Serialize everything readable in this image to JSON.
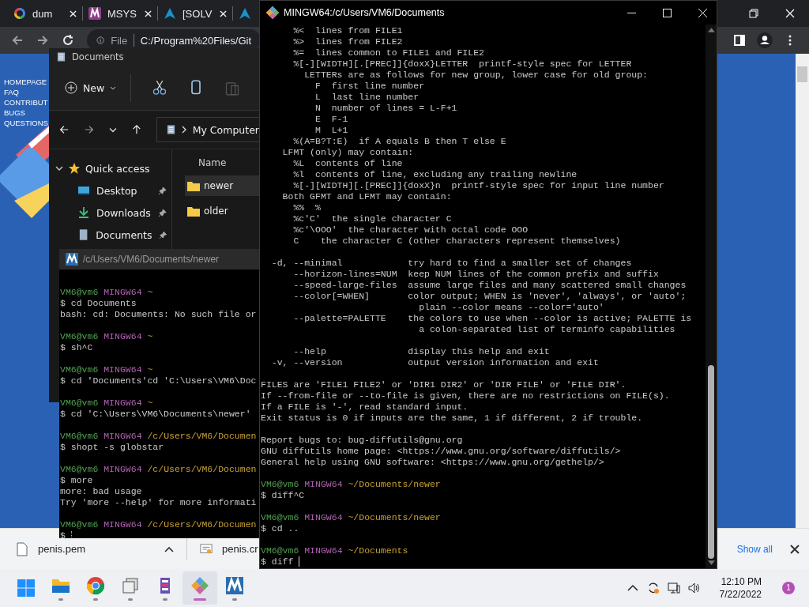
{
  "browser": {
    "tabs": [
      {
        "title": "dum",
        "kind": "ring"
      },
      {
        "title": "MSYS",
        "kind": "zigzag"
      },
      {
        "title": "[SOLV",
        "kind": "peak"
      },
      {
        "kind": "peak"
      }
    ],
    "address": {
      "scheme": "File",
      "url": "C:/Program%20Files/Git"
    },
    "page_links": [
      "HOMEPAGE",
      "FAQ",
      "CONTRIBUT",
      "BUGS",
      "QUESTIONS"
    ]
  },
  "explorer": {
    "title": "Documents",
    "new_button": "New",
    "breadcrumb": "My Computer",
    "column": "Name",
    "nav": [
      {
        "label": "Quick access",
        "expanded": true,
        "children": [
          {
            "label": "Desktop",
            "kind": "desktop",
            "pinned": true
          },
          {
            "label": "Downloads",
            "kind": "download",
            "pinned": true
          },
          {
            "label": "Documents",
            "kind": "document",
            "pinned": true
          }
        ]
      }
    ],
    "files": [
      {
        "name": "newer",
        "selected": true
      },
      {
        "name": "older",
        "selected": false
      }
    ]
  },
  "left_terminal": {
    "title": "/c/Users/VM6/Documents/newer",
    "focused": false,
    "lines": [
      {
        "kind": "blank"
      },
      {
        "kind": "prompt",
        "user": "VM6@vm6",
        "shell": "MINGW64",
        "path": "~"
      },
      {
        "kind": "text",
        "text": "$ cd Documents"
      },
      {
        "kind": "text",
        "text": "bash: cd: Documents: No such file or"
      },
      {
        "kind": "blank"
      },
      {
        "kind": "prompt",
        "user": "VM6@vm6",
        "shell": "MINGW64",
        "path": "~"
      },
      {
        "kind": "text",
        "text": "$ sh^C"
      },
      {
        "kind": "blank"
      },
      {
        "kind": "prompt",
        "user": "VM6@vm6",
        "shell": "MINGW64",
        "path": "~"
      },
      {
        "kind": "text",
        "text": "$ cd 'Documents'cd 'C:\\Users\\VM6\\Doc"
      },
      {
        "kind": "blank"
      },
      {
        "kind": "prompt",
        "user": "VM6@vm6",
        "shell": "MINGW64",
        "path": "~"
      },
      {
        "kind": "text",
        "text": "$ cd 'C:\\Users\\VM6\\Documents\\newer'"
      },
      {
        "kind": "blank"
      },
      {
        "kind": "prompt",
        "user": "VM6@vm6",
        "shell": "MINGW64",
        "path": "/c/Users/VM6/Documen"
      },
      {
        "kind": "text",
        "text": "$ shopt -s globstar"
      },
      {
        "kind": "blank"
      },
      {
        "kind": "prompt",
        "user": "VM6@vm6",
        "shell": "MINGW64",
        "path": "/c/Users/VM6/Documen"
      },
      {
        "kind": "text",
        "text": "$ more"
      },
      {
        "kind": "text",
        "text": "more: bad usage"
      },
      {
        "kind": "text",
        "text": "Try 'more --help' for more informati"
      },
      {
        "kind": "blank"
      },
      {
        "kind": "prompt",
        "user": "VM6@vm6",
        "shell": "MINGW64",
        "path": "/c/Users/VM6/Documen"
      },
      {
        "kind": "input",
        "text": "$ "
      }
    ]
  },
  "main_terminal": {
    "title": "MINGW64:/c/Users/VM6/Documents",
    "focused": true,
    "lines": [
      {
        "kind": "text",
        "text": "      %<  lines from FILE1"
      },
      {
        "kind": "text",
        "text": "      %>  lines from FILE2"
      },
      {
        "kind": "text",
        "text": "      %=  lines common to FILE1 and FILE2"
      },
      {
        "kind": "text",
        "text": "      %[-][WIDTH][.[PREC]]{doxX}LETTER  printf-style spec for LETTER"
      },
      {
        "kind": "text",
        "text": "        LETTERs are as follows for new group, lower case for old group:"
      },
      {
        "kind": "text",
        "text": "          F  first line number"
      },
      {
        "kind": "text",
        "text": "          L  last line number"
      },
      {
        "kind": "text",
        "text": "          N  number of lines = L-F+1"
      },
      {
        "kind": "text",
        "text": "          E  F-1"
      },
      {
        "kind": "text",
        "text": "          M  L+1"
      },
      {
        "kind": "text",
        "text": "      %(A=B?T:E)  if A equals B then T else E"
      },
      {
        "kind": "text",
        "text": "    LFMT (only) may contain:"
      },
      {
        "kind": "text",
        "text": "      %L  contents of line"
      },
      {
        "kind": "text",
        "text": "      %l  contents of line, excluding any trailing newline"
      },
      {
        "kind": "text",
        "text": "      %[-][WIDTH][.[PREC]]{doxX}n  printf-style spec for input line number"
      },
      {
        "kind": "text",
        "text": "    Both GFMT and LFMT may contain:"
      },
      {
        "kind": "text",
        "text": "      %%  %"
      },
      {
        "kind": "text",
        "text": "      %c'C'  the single character C"
      },
      {
        "kind": "text",
        "text": "      %c'\\OOO'  the character with octal code OOO"
      },
      {
        "kind": "text",
        "text": "      C    the character C (other characters represent themselves)"
      },
      {
        "kind": "blank"
      },
      {
        "kind": "text",
        "text": "  -d, --minimal            try hard to find a smaller set of changes"
      },
      {
        "kind": "text",
        "text": "      --horizon-lines=NUM  keep NUM lines of the common prefix and suffix"
      },
      {
        "kind": "text",
        "text": "      --speed-large-files  assume large files and many scattered small changes"
      },
      {
        "kind": "text",
        "text": "      --color[=WHEN]       color output; WHEN is 'never', 'always', or 'auto';"
      },
      {
        "kind": "text",
        "text": "                             plain --color means --color='auto'"
      },
      {
        "kind": "text",
        "text": "      --palette=PALETTE    the colors to use when --color is active; PALETTE is"
      },
      {
        "kind": "text",
        "text": "                             a colon-separated list of terminfo capabilities"
      },
      {
        "kind": "blank"
      },
      {
        "kind": "text",
        "text": "      --help               display this help and exit"
      },
      {
        "kind": "text",
        "text": "  -v, --version            output version information and exit"
      },
      {
        "kind": "blank"
      },
      {
        "kind": "text",
        "text": "FILES are 'FILE1 FILE2' or 'DIR1 DIR2' or 'DIR FILE' or 'FILE DIR'."
      },
      {
        "kind": "text",
        "text": "If --from-file or --to-file is given, there are no restrictions on FILE(s)."
      },
      {
        "kind": "text",
        "text": "If a FILE is '-', read standard input."
      },
      {
        "kind": "text",
        "text": "Exit status is 0 if inputs are the same, 1 if different, 2 if trouble."
      },
      {
        "kind": "blank"
      },
      {
        "kind": "text",
        "text": "Report bugs to: bug-diffutils@gnu.org"
      },
      {
        "kind": "text",
        "text": "GNU diffutils home page: <https://www.gnu.org/software/diffutils/>"
      },
      {
        "kind": "text",
        "text": "General help using GNU software: <https://www.gnu.org/gethelp/>"
      },
      {
        "kind": "blank"
      },
      {
        "kind": "prompt",
        "user": "VM6@vm6",
        "shell": "MINGW64",
        "path": "~/Documents/newer"
      },
      {
        "kind": "text",
        "text": "$ diff^C"
      },
      {
        "kind": "blank"
      },
      {
        "kind": "prompt",
        "user": "VM6@vm6",
        "shell": "MINGW64",
        "path": "~/Documents/newer"
      },
      {
        "kind": "text",
        "text": "$ cd .."
      },
      {
        "kind": "blank"
      },
      {
        "kind": "prompt",
        "user": "VM6@vm6",
        "shell": "MINGW64",
        "path": "~/Documents"
      },
      {
        "kind": "input",
        "text": "$ diff "
      }
    ]
  },
  "downloads": {
    "items": [
      {
        "name": "penis.pem",
        "kind": "file"
      },
      {
        "name": "penis.cr",
        "kind": "certificate"
      }
    ],
    "show_all": "Show all"
  },
  "taskbar": {
    "apps": [
      {
        "kind": "start",
        "running": false,
        "active": false
      },
      {
        "kind": "folder",
        "running": true,
        "active": false
      },
      {
        "kind": "browser",
        "running": true,
        "active": false
      },
      {
        "kind": "windows",
        "running": true,
        "active": false
      },
      {
        "kind": "tool",
        "running": true,
        "active": false
      },
      {
        "kind": "git",
        "running": true,
        "active": true
      },
      {
        "kind": "zigzag",
        "running": true,
        "active": false
      }
    ],
    "time": "12:10 PM",
    "date": "7/22/2022",
    "notifications": "1"
  }
}
